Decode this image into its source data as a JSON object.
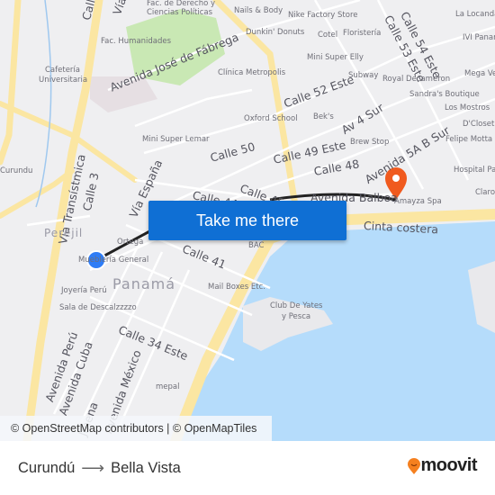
{
  "map": {
    "colors": {
      "water": "#b5dcfb",
      "land": "#efeff1",
      "major_road": "#fbe6a2",
      "park": "#c9e8b4",
      "route": "#222222",
      "origin": "#2f7df6",
      "destination": "#f05a1e"
    },
    "streets": [
      "Vía Transístmica",
      "Calle 3",
      "Vía España",
      "Avenida José de Fábrega",
      "Calle 50",
      "Calle 52 Este",
      "Calle 49 Este",
      "Calle 48",
      "Av 4 Sur",
      "Avenida 5A B Sur",
      "Calle 54 Este",
      "Calle 53 Este",
      "Calle 44",
      "Calle 45",
      "Calle 41",
      "Calle 34 Este",
      "Avenida Perú",
      "Avenida Cuba",
      "Avenida México",
      "Cinta costera",
      "Avenida Balboa",
      "Calle",
      "Vía",
      "Jmena"
    ],
    "places": [
      "Fac. de Derecho y",
      "Ciencias Políticas",
      "Fac. Humanidades",
      "Cafetería",
      "Universitaria",
      "Nails & Body",
      "Nike Factory Store",
      "Dunkin' Donuts",
      "Cotel",
      "Floristería",
      "Mini Super Elly",
      "Clínica Metropolis",
      "Subway",
      "Royal Decameron",
      "Oxford School",
      "Bek's",
      "Mini Super Lemar",
      "Brew Stop",
      "Sandra's Boutique",
      "Los Mostros",
      "D'Closet",
      "Felipe Motta",
      "Hospital Pa",
      "La Locanda",
      "IVI Panam",
      "Mega Ve",
      "Claro",
      "Amayza Spa",
      "Ortega",
      "Mueblería General",
      "Joyería Perú",
      "Sala de Descalzzzzo",
      "BAC",
      "Mail Boxes Etc.",
      "Club De Yates",
      "y Pesca",
      "mepal",
      "Curundu",
      "Perejil",
      "Panamá"
    ]
  },
  "button": {
    "label": "Take me there"
  },
  "attribution": "© OpenStreetMap contributors | © OpenMapTiles",
  "footer": {
    "origin": "Curundú",
    "arrow": "⟶",
    "destination": "Bella Vista",
    "brand": "moovit"
  }
}
